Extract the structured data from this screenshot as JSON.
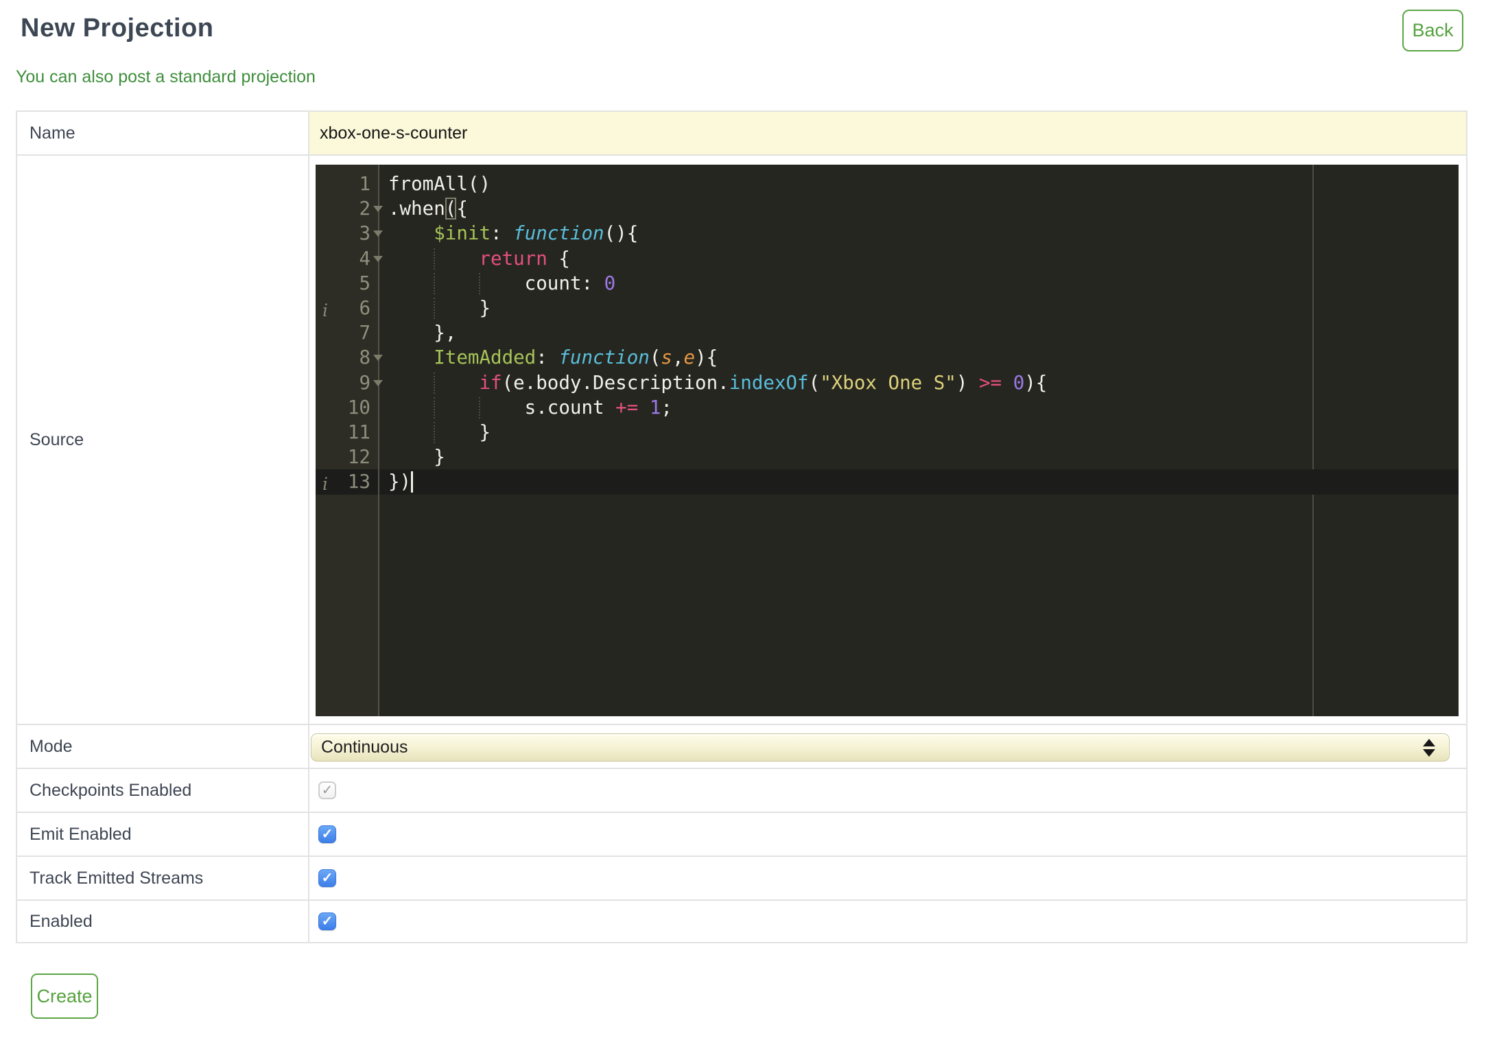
{
  "page": {
    "title": "New Projection",
    "back_label": "Back",
    "link_text": "You can also post a standard projection",
    "create_label": "Create"
  },
  "colors": {
    "accent_green": "#55a23e",
    "link_green": "#3e8e3b",
    "input_yellow": "#fcf9da",
    "checkbox_blue": "#4285ec",
    "editor_background": "#262621",
    "syntax": {
      "plain": "#f1f1ea",
      "property": "#a6c457",
      "keyword": "#e4507d",
      "function": "#5abeda",
      "number": "#9c79e8",
      "string": "#ddd17a",
      "parameter": "#e79942",
      "line_number": "#8f8f7e"
    }
  },
  "form": {
    "rows": [
      {
        "label": "Name",
        "value": "xbox-one-s-counter"
      },
      {
        "label": "Source"
      },
      {
        "label": "Mode",
        "value": "Continuous"
      },
      {
        "label": "Checkpoints Enabled",
        "checked": true,
        "disabled": true
      },
      {
        "label": "Emit Enabled",
        "checked": true,
        "disabled": false
      },
      {
        "label": "Track Emitted Streams",
        "checked": true,
        "disabled": false
      },
      {
        "label": "Enabled",
        "checked": true,
        "disabled": false
      }
    ]
  },
  "editor": {
    "line_count": 13,
    "active_line": 13,
    "cursor": {
      "line": 13,
      "col": 2
    },
    "info_lines": [
      6,
      13
    ],
    "fold_lines": [
      2,
      3,
      4,
      8,
      9
    ],
    "indent_guides": {
      "4": [
        4
      ],
      "5": [
        4,
        8
      ],
      "6": [
        4
      ],
      "9": [
        4
      ],
      "10": [
        4,
        8
      ],
      "11": [
        4
      ]
    },
    "lines": [
      [
        [
          "fromAll()",
          "p"
        ]
      ],
      [
        [
          ".when",
          "p"
        ],
        [
          "(",
          "p match"
        ],
        [
          "{",
          "p"
        ]
      ],
      [
        [
          "    ",
          "p"
        ],
        [
          "$init",
          "lime"
        ],
        [
          ":",
          "p"
        ],
        [
          " ",
          "p"
        ],
        [
          "function",
          "cyan"
        ],
        [
          "(){",
          "p"
        ]
      ],
      [
        [
          "        ",
          "p"
        ],
        [
          "return",
          "pink"
        ],
        [
          " {",
          "p"
        ]
      ],
      [
        [
          "            count: ",
          "p"
        ],
        [
          "0",
          "purple"
        ]
      ],
      [
        [
          "        }",
          "p"
        ]
      ],
      [
        [
          "    },",
          "p"
        ]
      ],
      [
        [
          "    ",
          "p"
        ],
        [
          "ItemAdded",
          "lime"
        ],
        [
          ": ",
          "p"
        ],
        [
          "function",
          "cyan"
        ],
        [
          "(",
          "p"
        ],
        [
          "s",
          "orange"
        ],
        [
          ",",
          "p"
        ],
        [
          "e",
          "orange"
        ],
        [
          "){",
          "p"
        ]
      ],
      [
        [
          "        ",
          "p"
        ],
        [
          "if",
          "pink"
        ],
        [
          "(e.body.Description.",
          "p"
        ],
        [
          "indexOf",
          "cyanu"
        ],
        [
          "(",
          "p"
        ],
        [
          "\"Xbox One S\"",
          "str"
        ],
        [
          ") ",
          "p"
        ],
        [
          ">=",
          "pink"
        ],
        [
          " ",
          "p"
        ],
        [
          "0",
          "purple"
        ],
        [
          "){",
          "p"
        ]
      ],
      [
        [
          "            s.count ",
          "p"
        ],
        [
          "+=",
          "pink"
        ],
        [
          " ",
          "p"
        ],
        [
          "1",
          "purple"
        ],
        [
          ";",
          "p"
        ]
      ],
      [
        [
          "        }",
          "p"
        ]
      ],
      [
        [
          "    }",
          "p"
        ]
      ],
      [
        [
          "})",
          "p"
        ]
      ]
    ]
  }
}
